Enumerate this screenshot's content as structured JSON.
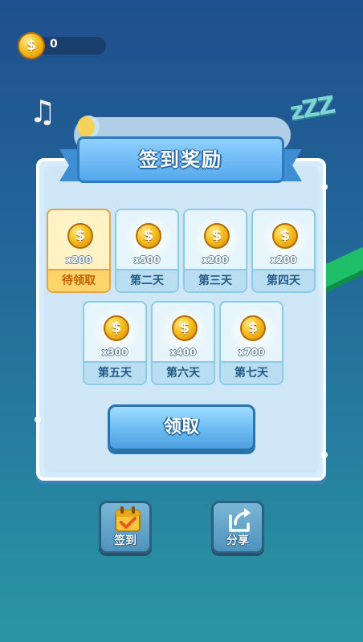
{
  "header": {
    "coin_count": "0",
    "coin_symbol": "$"
  },
  "background": {
    "zzz": "zZZ"
  },
  "dialog": {
    "title": "签到奖励",
    "days": [
      {
        "amount": "x200",
        "label": "待领取",
        "state": "pending"
      },
      {
        "amount": "x500",
        "label": "第二天",
        "state": "locked"
      },
      {
        "amount": "x200",
        "label": "第三天",
        "state": "locked"
      },
      {
        "amount": "x200",
        "label": "第四天",
        "state": "locked"
      },
      {
        "amount": "x300",
        "label": "第五天",
        "state": "locked"
      },
      {
        "amount": "x400",
        "label": "第六天",
        "state": "locked"
      },
      {
        "amount": "x700",
        "label": "第七天",
        "state": "locked"
      }
    ],
    "claim_label": "领取"
  },
  "bottom_bar": {
    "checkin_label": "签到",
    "share_label": "分享"
  },
  "colors": {
    "accent": "#55a8ec",
    "active_day": "#ffd56b",
    "coin": "#f5c020"
  }
}
